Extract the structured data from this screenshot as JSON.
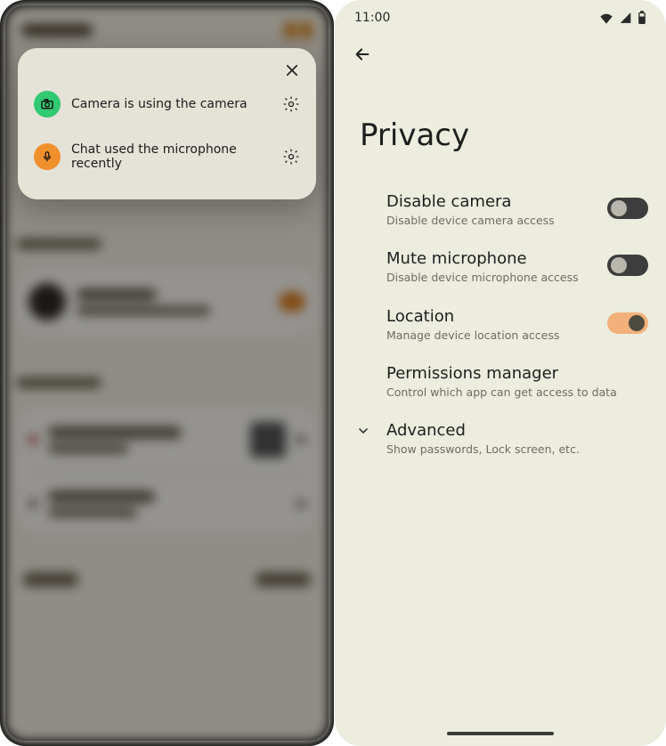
{
  "left_popup": {
    "camera_row": {
      "icon": "camera",
      "text": "Camera is using the camera"
    },
    "mic_row": {
      "icon": "microphone",
      "text": "Chat used the microphone recently"
    }
  },
  "right_screen": {
    "status_time": "11:00",
    "page_title": "Privacy",
    "prefs": {
      "camera": {
        "title": "Disable camera",
        "subtitle": "Disable device camera access",
        "on": false
      },
      "mic": {
        "title": "Mute microphone",
        "subtitle": "Disable device microphone access",
        "on": false
      },
      "location": {
        "title": "Location",
        "subtitle": "Manage device location access",
        "on": true
      },
      "permissions": {
        "title": "Permissions manager",
        "subtitle": "Control which app can get access to data"
      },
      "advanced": {
        "title": "Advanced",
        "subtitle": "Show passwords, Lock screen, etc."
      }
    }
  }
}
